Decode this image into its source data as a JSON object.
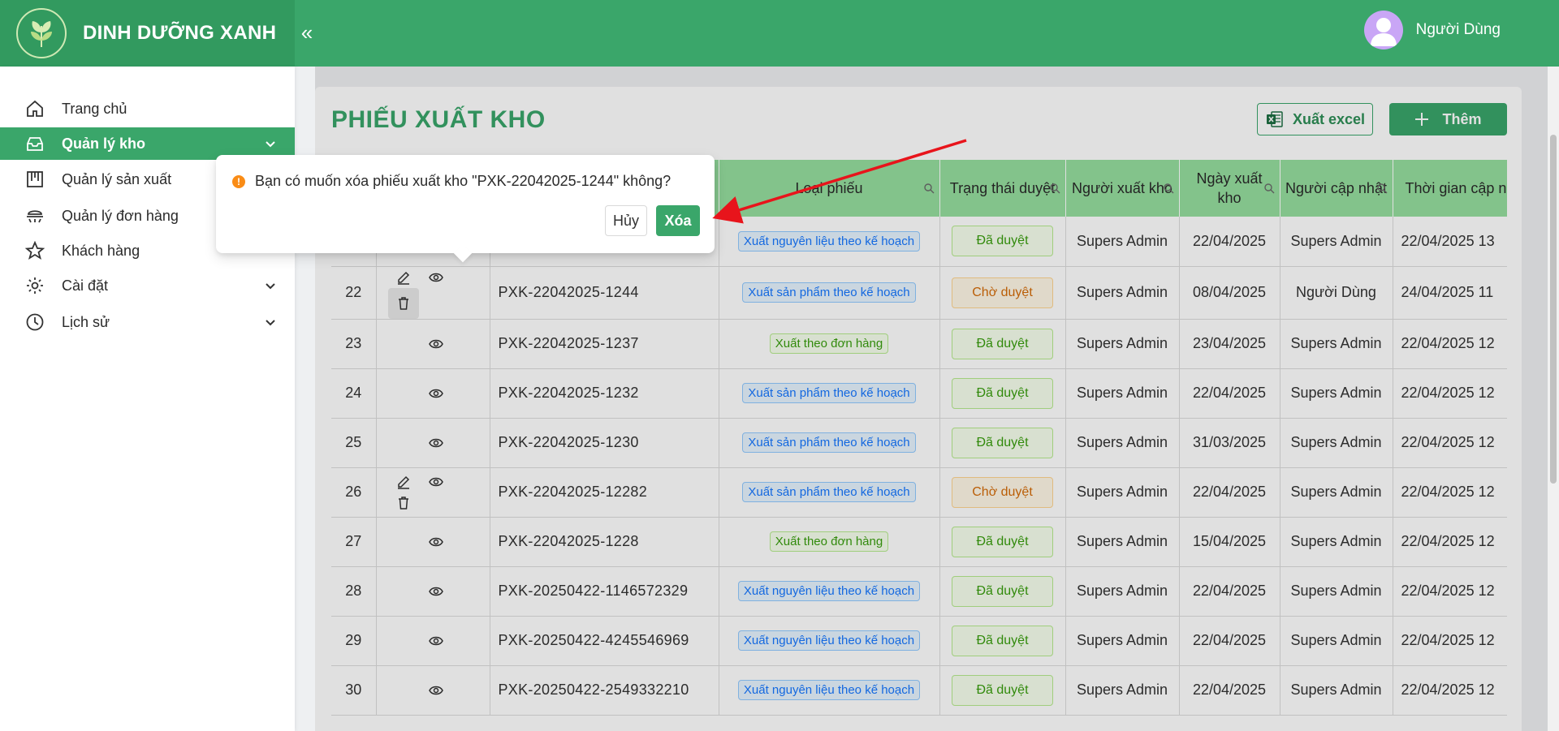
{
  "brand": {
    "name": "DINH DƯỠNG XANH"
  },
  "user": {
    "name": "Người Dùng"
  },
  "sidebar": {
    "items": [
      {
        "label": "Trang chủ"
      },
      {
        "label": "Quản lý kho"
      },
      {
        "label": "Quản lý sản xuất"
      },
      {
        "label": "Quản lý đơn hàng"
      },
      {
        "label": "Khách hàng"
      },
      {
        "label": "Cài đặt"
      },
      {
        "label": "Lịch sử"
      }
    ]
  },
  "page": {
    "title": "PHIẾU XUẤT KHO",
    "excel_label": "Xuất excel",
    "add_label": "Thêm"
  },
  "table": {
    "headers": [
      "Loại phiếu",
      "Trạng thái duyệt",
      "Người xuất kho",
      "Ngày xuất kho",
      "Người cập nhật",
      "Thời gian cập nhật"
    ],
    "rows": [
      {
        "stt": "",
        "code": "",
        "type": "Xuất nguyên liệu theo kế hoạch",
        "status": "Đã duyệt",
        "exporter": "Supers Admin",
        "date": "22/04/2025",
        "updater": "Supers Admin",
        "updated": "22/04/2025 13"
      },
      {
        "stt": "22",
        "code": "PXK-22042025-1244",
        "type": "Xuất sản phẩm theo kế hoạch",
        "status": "Chờ duyệt",
        "exporter": "Supers Admin",
        "date": "08/04/2025",
        "updater": "Người Dùng",
        "updated": "24/04/2025 11"
      },
      {
        "stt": "23",
        "code": "PXK-22042025-1237",
        "type": "Xuất theo đơn hàng",
        "status": "Đã duyệt",
        "exporter": "Supers Admin",
        "date": "23/04/2025",
        "updater": "Supers Admin",
        "updated": "22/04/2025 12"
      },
      {
        "stt": "24",
        "code": "PXK-22042025-1232",
        "type": "Xuất sản phẩm theo kế hoạch",
        "status": "Đã duyệt",
        "exporter": "Supers Admin",
        "date": "22/04/2025",
        "updater": "Supers Admin",
        "updated": "22/04/2025 12"
      },
      {
        "stt": "25",
        "code": "PXK-22042025-1230",
        "type": "Xuất sản phẩm theo kế hoạch",
        "status": "Đã duyệt",
        "exporter": "Supers Admin",
        "date": "31/03/2025",
        "updater": "Supers Admin",
        "updated": "22/04/2025 12"
      },
      {
        "stt": "26",
        "code": "PXK-22042025-12282",
        "type": "Xuất sản phẩm theo kế hoạch",
        "status": "Chờ duyệt",
        "exporter": "Supers Admin",
        "date": "22/04/2025",
        "updater": "Supers Admin",
        "updated": "22/04/2025 12"
      },
      {
        "stt": "27",
        "code": "PXK-22042025-1228",
        "type": "Xuất theo đơn hàng",
        "status": "Đã duyệt",
        "exporter": "Supers Admin",
        "date": "15/04/2025",
        "updater": "Supers Admin",
        "updated": "22/04/2025 12"
      },
      {
        "stt": "28",
        "code": "PXK-20250422-1146572329",
        "type": "Xuất nguyên liệu theo kế hoạch",
        "status": "Đã duyệt",
        "exporter": "Supers Admin",
        "date": "22/04/2025",
        "updater": "Supers Admin",
        "updated": "22/04/2025 12"
      },
      {
        "stt": "29",
        "code": "PXK-20250422-4245546969",
        "type": "Xuất nguyên liệu theo kế hoạch",
        "status": "Đã duyệt",
        "exporter": "Supers Admin",
        "date": "22/04/2025",
        "updater": "Supers Admin",
        "updated": "22/04/2025 12"
      },
      {
        "stt": "30",
        "code": "PXK-20250422-2549332210",
        "type": "Xuất nguyên liệu theo kế hoạch",
        "status": "Đã duyệt",
        "exporter": "Supers Admin",
        "date": "22/04/2025",
        "updater": "Supers Admin",
        "updated": "22/04/2025 12"
      }
    ]
  },
  "popconfirm": {
    "message": "Bạn có muốn xóa phiếu xuất kho \"PXK-22042025-1244\" không?",
    "cancel_label": "Hủy",
    "confirm_label": "Xóa"
  },
  "colors": {
    "primary": "#3aa66a",
    "header_bg": "#96df9f",
    "annotation_arrow": "#e8141b"
  }
}
